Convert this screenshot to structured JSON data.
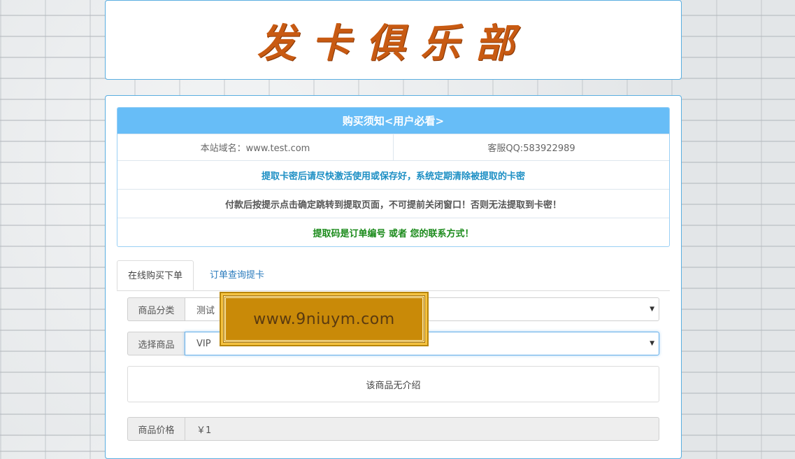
{
  "logo": {
    "text": "发卡俱乐部"
  },
  "notice": {
    "title": "购买须知<用户必看>",
    "domain": "本站域名：www.test.com",
    "service_qq": "客服QQ:583922989",
    "line1": "提取卡密后请尽快激活使用或保存好，系统定期清除被提取的卡密",
    "line2": "付款后按提示点击确定跳转到提取页面，不可提前关闭窗口！否则无法提取到卡密！",
    "line3": "提取码是订单编号 或者 您的联系方式！"
  },
  "tabs": [
    {
      "label": "在线购买下单",
      "active": true
    },
    {
      "label": "订单查询提卡",
      "active": false
    }
  ],
  "form": {
    "category": {
      "label": "商品分类",
      "value": "测试"
    },
    "product": {
      "label": "选择商品",
      "value": "VIP"
    },
    "description": "该商品无介绍",
    "price": {
      "label": "商品价格",
      "value": "￥1"
    }
  },
  "watermark": {
    "text": "www.9niuym.com"
  },
  "colors": {
    "notice_header": "#67bdf7",
    "panel_border": "#5aaee0",
    "logo": "#c85a12",
    "line1": "#1d8fc4",
    "line3": "#1a8a1a",
    "watermark_bg": "#c98a08"
  }
}
